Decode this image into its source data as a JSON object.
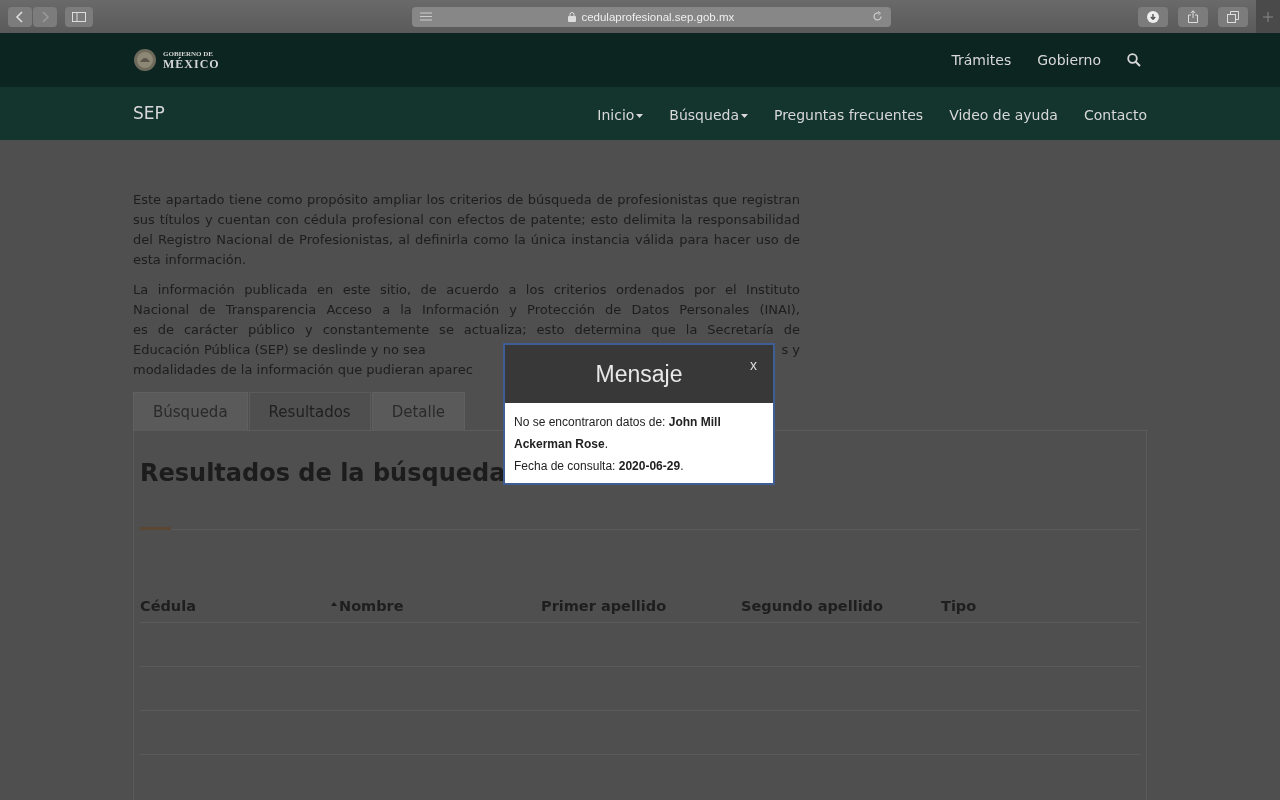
{
  "browser": {
    "url": "cedulaprofesional.sep.gob.mx"
  },
  "gov_header": {
    "logo_top": "GOBIERNO DE",
    "logo_bottom": "MÉXICO",
    "links": [
      "Trámites",
      "Gobierno"
    ]
  },
  "site_nav": {
    "brand": "SEP",
    "items": [
      {
        "label": "Inicio",
        "dropdown": true
      },
      {
        "label": "Búsqueda",
        "dropdown": true
      },
      {
        "label": "Preguntas frecuentes",
        "dropdown": false
      },
      {
        "label": "Video de ayuda",
        "dropdown": false
      },
      {
        "label": "Contacto",
        "dropdown": false
      }
    ]
  },
  "intro": {
    "paragraph_1": "Este apartado tiene como propósito ampliar los criterios de búsqueda de profesionistas que registran sus títulos y cuentan con cédula profesional con efectos de patente; esto delimita la responsabilidad del Registro Nacional de Profesionistas, al definirla como la única instancia válida para hacer uso de esta información.",
    "paragraph_2_lines": [
      "La información publicada en este sitio, de acuerdo a los criterios ordenados por el Instituto",
      "Nacional de Transparencia  Acceso a la Información y Protección de Datos Personales (INAI),",
      "es de carácter público y constantemente se actualiza; esto determina que la Secretaría de"
    ],
    "paragraph_2_line_4": [
      "Educación Pública (SEP) se deslinde y no sea",
      "s y"
    ],
    "paragraph_2_line_5": "modalidades de la información que pudieran aparec"
  },
  "tabs": [
    {
      "label": "Búsqueda",
      "selected": false
    },
    {
      "label": "Resultados",
      "selected": true
    },
    {
      "label": "Detalle",
      "selected": false
    }
  ],
  "results": {
    "title": "Resultados de la búsqueda",
    "columns": [
      {
        "label": "Cédula",
        "sorted": false
      },
      {
        "label": "Nombre",
        "sorted": true
      },
      {
        "label": "Primer apellido",
        "sorted": false
      },
      {
        "label": "Segundo apellido",
        "sorted": false
      },
      {
        "label": "Tipo",
        "sorted": false
      }
    ]
  },
  "modal": {
    "title": "Mensaje",
    "close": "x",
    "lines": [
      "No se encontraron datos de: **John Mill Ackerman Rose**.",
      "Fecha de consulta: **2020-06-29**."
    ]
  }
}
